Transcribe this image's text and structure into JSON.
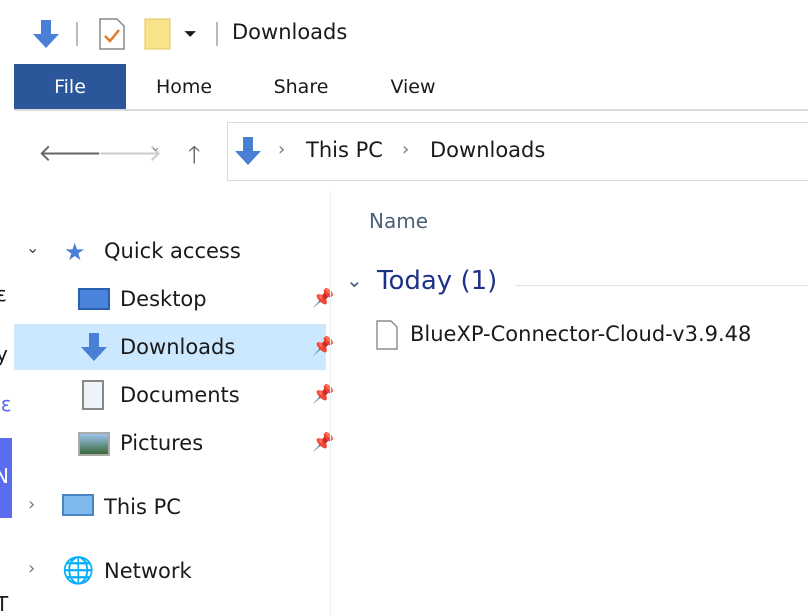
{
  "title_bar": {
    "title": "Downloads"
  },
  "ribbon": {
    "tabs": [
      "File",
      "Home",
      "Share",
      "View"
    ]
  },
  "address": {
    "crumbs": [
      "This PC",
      "Downloads"
    ]
  },
  "nav": {
    "quick_access": "Quick access",
    "items": [
      "Desktop",
      "Downloads",
      "Documents",
      "Pictures"
    ],
    "this_pc": "This PC",
    "network": "Network"
  },
  "content": {
    "column_name": "Name",
    "group": "Today (1)",
    "files": [
      "BlueXP-Connector-Cloud-v3.9.48"
    ]
  },
  "background_fragments": [
    "ε",
    "y",
    "ιε",
    "N",
    "T"
  ],
  "colors": {
    "accent": "#2b579a",
    "selected": "#cce8ff",
    "group_text": "#1e3287"
  }
}
